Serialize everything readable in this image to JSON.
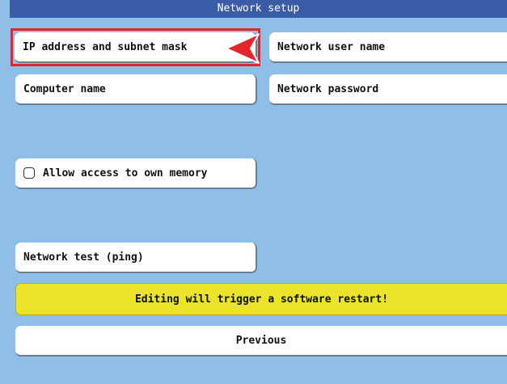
{
  "window": {
    "title": "Network setup"
  },
  "buttons": {
    "ip_address": "IP address and subnet mask",
    "network_user_name": "Network user name",
    "computer_name": "Computer name",
    "network_password": "Network password",
    "allow_access": "Allow access to own memory",
    "network_test": "Network test (ping)",
    "previous": "Previous"
  },
  "checkbox": {
    "allow_access_checked": false
  },
  "warning": {
    "text": "Editing will trigger a software restart!"
  },
  "colors": {
    "background": "#8fbfe6",
    "titlebar": "#3a5ba6",
    "warning": "#ece42b",
    "highlight": "#e3262b"
  },
  "icons": {
    "highlight_pointer": "red-arrow-pointer-icon",
    "checkbox": "checkbox-icon"
  }
}
